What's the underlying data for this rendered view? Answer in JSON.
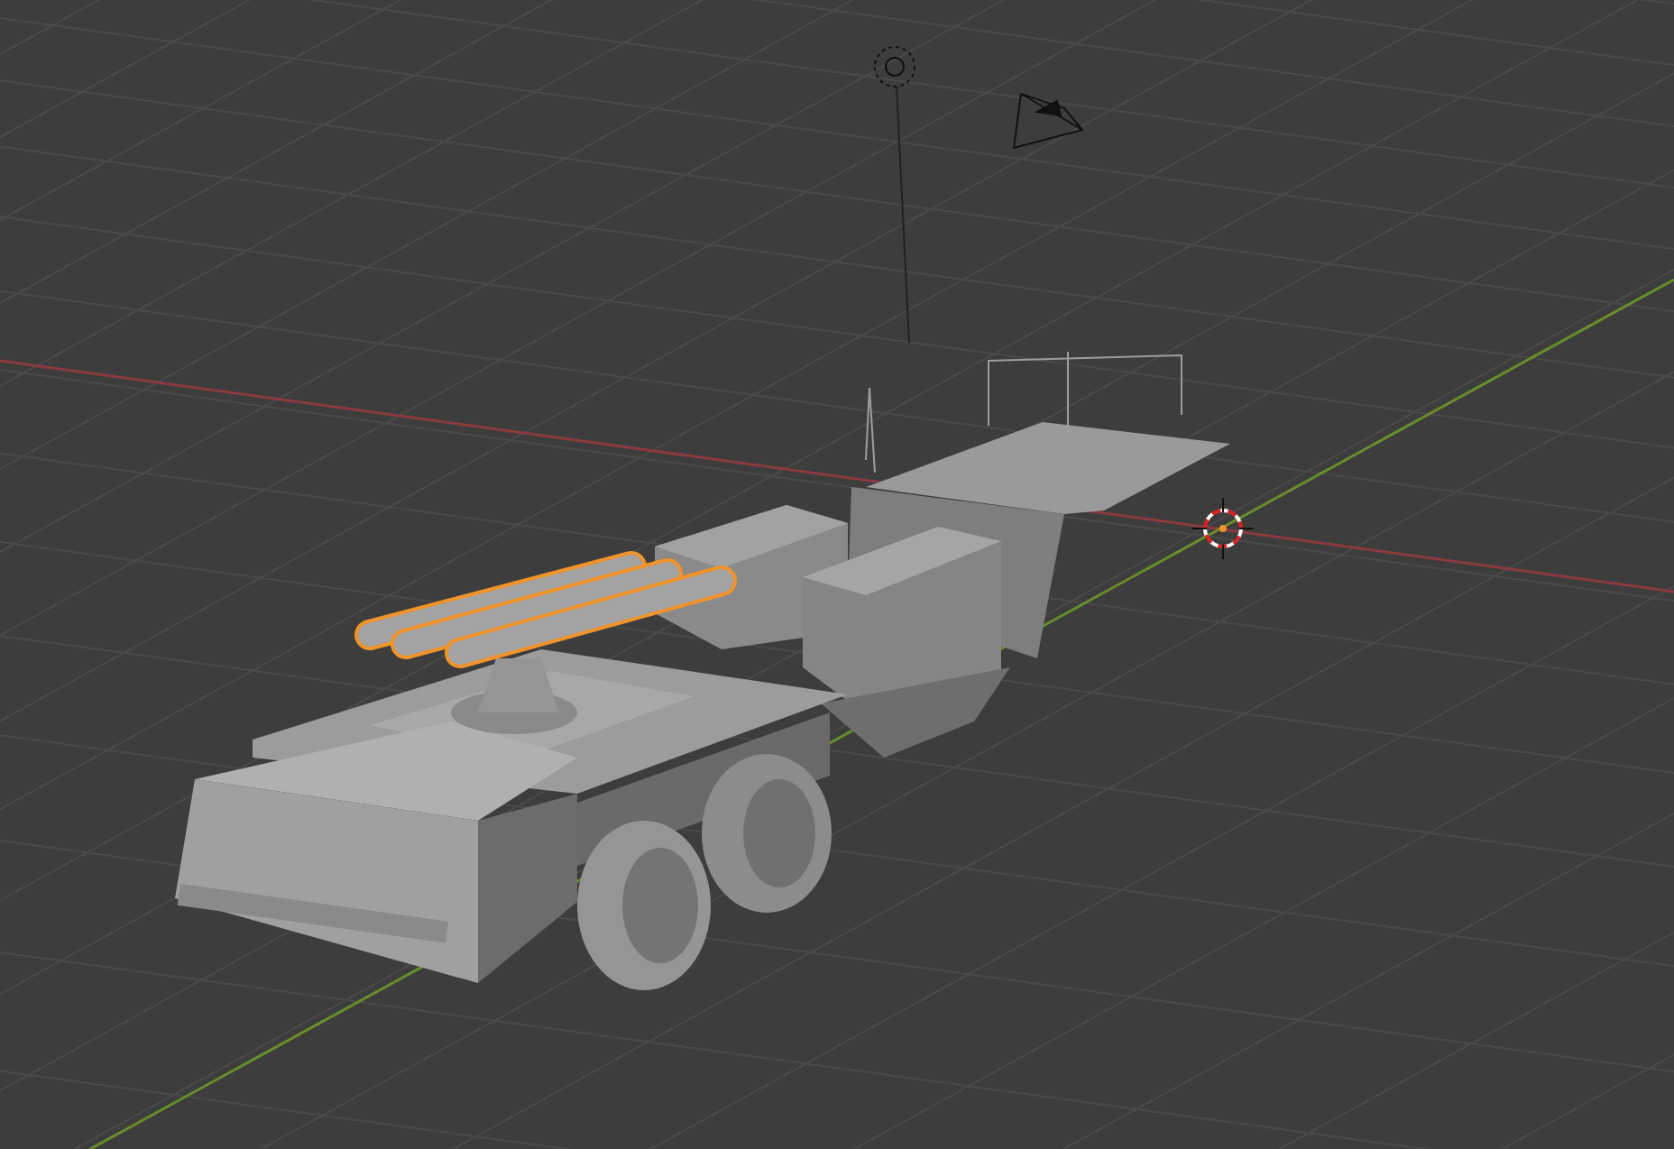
{
  "viewport": {
    "launcher": {
      "selected": true
    }
  }
}
